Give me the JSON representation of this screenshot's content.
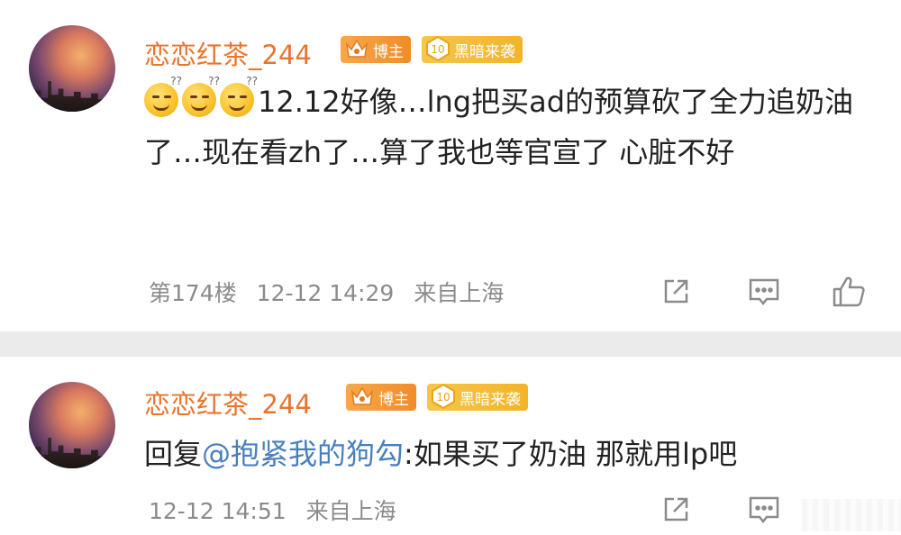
{
  "posts": [
    {
      "username": "恋恋红茶_244",
      "badges": [
        {
          "label": "博主",
          "icon": "crown-icon",
          "color": "#f08c2a"
        },
        {
          "label": "黑暗来袭",
          "icon": "level-10-icon",
          "level": "10",
          "color": "#f2b42a"
        }
      ],
      "emojis": [
        "sleepy-smile-emoji",
        "sleepy-smile-emoji",
        "sleepy-smile-emoji"
      ],
      "content": "12.12好像…lng把买ad的预算砍了全力追奶油了…现在看zh了…算了我也等官宣了 心脏不好",
      "floor": "第174楼",
      "time": "12-12 14:29",
      "location": "来自上海"
    },
    {
      "username": "恋恋红茶_244",
      "badges": [
        {
          "label": "博主",
          "icon": "crown-icon",
          "color": "#f08c2a"
        },
        {
          "label": "黑暗来袭",
          "icon": "level-10-icon",
          "level": "10",
          "color": "#f2b42a"
        }
      ],
      "reply_prefix": "回复",
      "mention": "@抱紧我的狗勾",
      "content": ":如果买了奶油 那就用lp吧",
      "time": "12-12 14:51",
      "location": "来自上海"
    }
  ],
  "icons": {
    "share": "share-icon",
    "comment": "comment-icon",
    "like": "thumbs-up-icon"
  },
  "colors": {
    "username": "#e8742e",
    "meta": "#8b8b8b",
    "mention": "#4a7fbf",
    "separator": "#ebebeb"
  }
}
